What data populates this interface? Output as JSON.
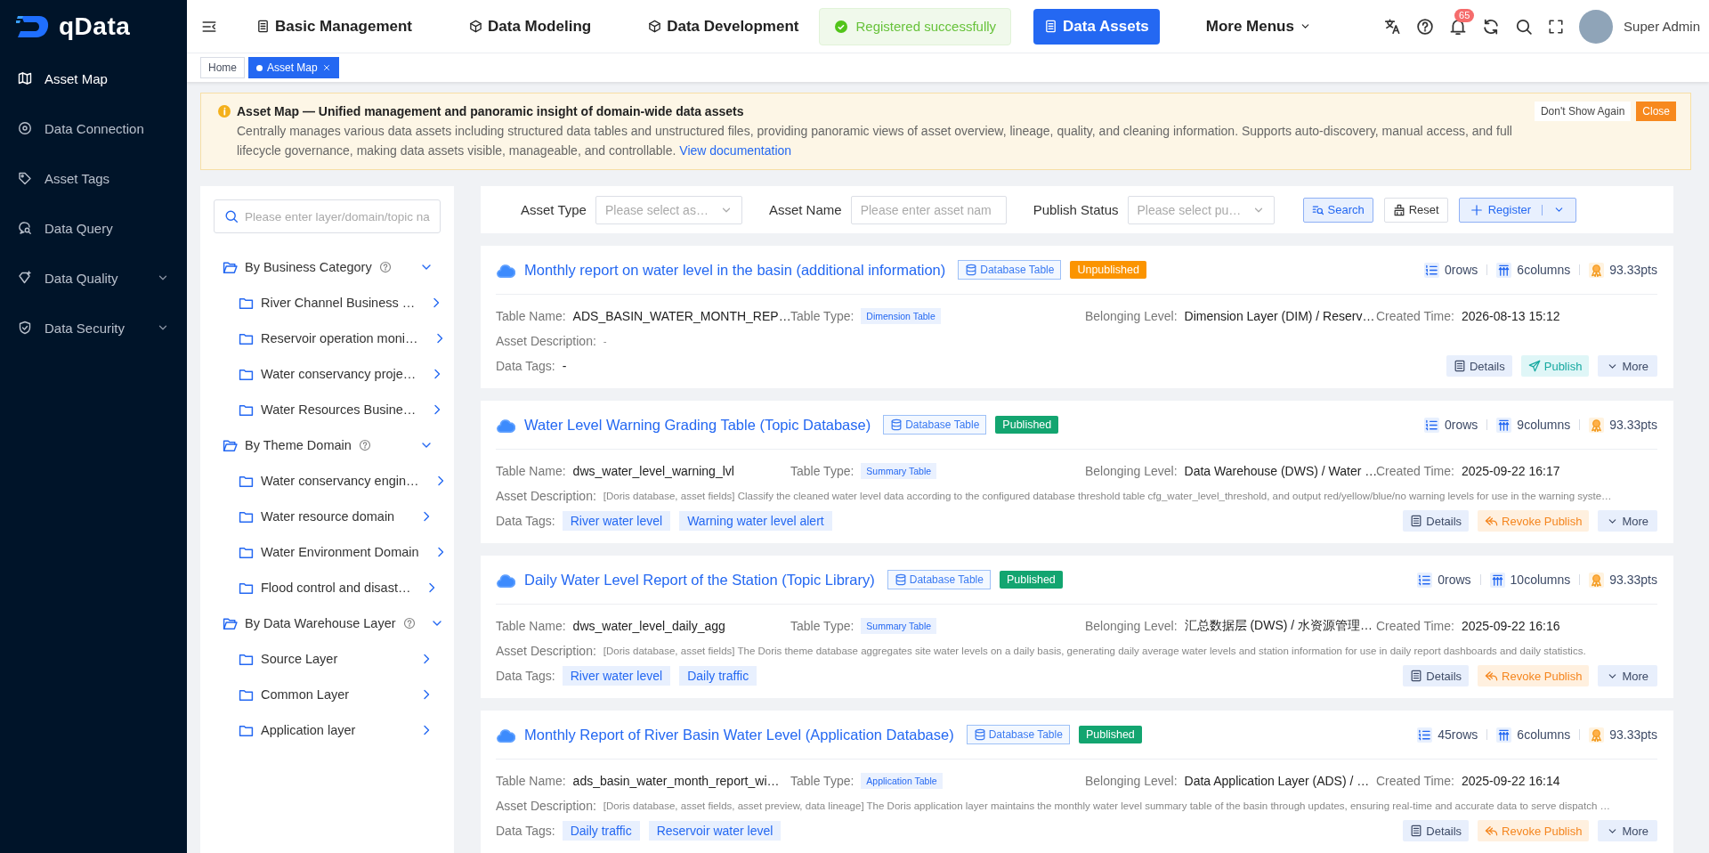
{
  "brand": {
    "name": "qData"
  },
  "sidebar": {
    "items": [
      {
        "label": "Asset Map",
        "selected": true,
        "kind": "link"
      },
      {
        "label": "Data Connection",
        "selected": false,
        "kind": "link"
      },
      {
        "label": "Asset Tags",
        "selected": false,
        "kind": "link"
      },
      {
        "label": "Data Query",
        "selected": false,
        "kind": "link"
      },
      {
        "label": "Data Quality",
        "selected": false,
        "kind": "group"
      },
      {
        "label": "Data Security",
        "selected": false,
        "kind": "group"
      }
    ]
  },
  "topbar": {
    "menus": [
      {
        "label": "Basic Management",
        "selected": false,
        "kind": "link"
      },
      {
        "label": "Data Modeling",
        "selected": false,
        "kind": "link"
      },
      {
        "label": "Data Development",
        "selected": false,
        "kind": "link"
      },
      {
        "label": "Data Assets",
        "selected": true,
        "kind": "link"
      },
      {
        "label": "More Menus",
        "selected": false,
        "kind": "dropdown"
      }
    ],
    "toast": "Registered successfully",
    "notification_count": "65",
    "user": "Super Admin"
  },
  "page_tabs": [
    {
      "label": "Home",
      "selected": false,
      "closable": false
    },
    {
      "label": "Asset Map",
      "selected": true,
      "closable": true
    }
  ],
  "notice": {
    "title": "Asset Map — Unified management and panoramic insight of domain-wide data assets",
    "body": "Centrally manages various data assets including structured data tables and unstructured files, providing panoramic views of asset overview, lineage, quality, and cleaning information. Supports auto-discovery, manual access, and full lifecycle governance, making data assets visible, manageable, and controllable.",
    "link": "View documentation",
    "dismiss": "Don't Show Again",
    "close": "Close"
  },
  "tree": {
    "search_placeholder": "Please enter layer/domain/topic na",
    "groups": [
      {
        "label": "By Business Category",
        "expanded": true,
        "children": [
          {
            "label": "River Channel Business …"
          },
          {
            "label": "Reservoir operation moni…"
          },
          {
            "label": "Water conservancy proje…"
          },
          {
            "label": "Water Resources Busine…"
          }
        ]
      },
      {
        "label": "By Theme Domain",
        "expanded": true,
        "children": [
          {
            "label": "Water conservancy engin…"
          },
          {
            "label": "Water resource domain"
          },
          {
            "label": "Water Environment Domain"
          },
          {
            "label": "Flood control and disast…"
          }
        ]
      },
      {
        "label": "By Data Warehouse Layer",
        "expanded": true,
        "children": [
          {
            "label": "Source Layer"
          },
          {
            "label": "Common Layer"
          },
          {
            "label": "Application layer"
          }
        ]
      }
    ]
  },
  "filters": {
    "fields": [
      {
        "label": "Asset Type",
        "kind": "select",
        "placeholder": "Please select as…"
      },
      {
        "label": "Asset Name",
        "kind": "input",
        "placeholder": "Please enter asset nam"
      },
      {
        "label": "Publish Status",
        "kind": "select",
        "placeholder": "Please select pu…"
      }
    ],
    "buttons": [
      {
        "label": "Search",
        "kind": "search"
      },
      {
        "label": "Reset",
        "kind": "reset"
      },
      {
        "label": "Register",
        "kind": "split"
      }
    ]
  },
  "assets": [
    {
      "title": "Monthly report on water level in the basin (additional information)",
      "type_tag": "Database Table",
      "status": {
        "label": "Unpublished",
        "kind": "unpublished"
      },
      "rows": "0rows",
      "columns": "6columns",
      "score": "93.33pts",
      "fields": [
        {
          "label": "Table Name:",
          "value": "ADS_BASIN_WATER_MONTH_REP…",
          "kind": "text"
        },
        {
          "label": "Table Type:",
          "value": "Dimension Table",
          "kind": "tag"
        },
        {
          "label": "Belonging Level:",
          "value": "Dimension Layer (DIM) / Reserv…",
          "kind": "text"
        },
        {
          "label": "Created Time:",
          "value": "2026-08-13 15:12",
          "kind": "text"
        }
      ],
      "description": {
        "label": "Asset Description:",
        "value": "-"
      },
      "tags": {
        "label": "Data Tags:",
        "text": "-"
      },
      "actions": [
        {
          "label": "Details",
          "kind": "details"
        },
        {
          "label": "Publish",
          "kind": "publish"
        },
        {
          "label": "More",
          "kind": "more"
        }
      ]
    },
    {
      "title": "Water Level Warning Grading Table (Topic Database)",
      "type_tag": "Database Table",
      "status": {
        "label": "Published",
        "kind": "published"
      },
      "rows": "0rows",
      "columns": "9columns",
      "score": "93.33pts",
      "fields": [
        {
          "label": "Table Name:",
          "value": "dws_water_level_warning_lvl",
          "kind": "text"
        },
        {
          "label": "Table Type:",
          "value": "Summary Table",
          "kind": "tag"
        },
        {
          "label": "Belonging Level:",
          "value": "Data Warehouse (DWS) / Water …",
          "kind": "text"
        },
        {
          "label": "Created Time:",
          "value": "2025-09-22 16:17",
          "kind": "text"
        }
      ],
      "description": {
        "label": "Asset Description:",
        "value": "[Doris database, asset fields] Classify the cleaned water level data according to the configured database threshold table cfg_water_level_threshold, and output red/yellow/blue/no warning levels for use in the warning syste…"
      },
      "tags": {
        "label": "Data Tags:",
        "items": [
          "River water level",
          "Warning water level alert"
        ]
      },
      "actions": [
        {
          "label": "Details",
          "kind": "details"
        },
        {
          "label": "Revoke Publish",
          "kind": "revoke"
        },
        {
          "label": "More",
          "kind": "more"
        }
      ]
    },
    {
      "title": "Daily Water Level Report of the Station (Topic Library)",
      "type_tag": "Database Table",
      "status": {
        "label": "Published",
        "kind": "published"
      },
      "rows": "0rows",
      "columns": "10columns",
      "score": "93.33pts",
      "fields": [
        {
          "label": "Table Name:",
          "value": "dws_water_level_daily_agg",
          "kind": "text"
        },
        {
          "label": "Table Type:",
          "value": "Summary Table",
          "kind": "tag"
        },
        {
          "label": "Belonging Level:",
          "value": "汇总数据层 (DWS) / 水资源管理…",
          "kind": "text"
        },
        {
          "label": "Created Time:",
          "value": "2025-09-22 16:16",
          "kind": "text"
        }
      ],
      "description": {
        "label": "Asset Description:",
        "value": "[Doris database, asset fields] The Doris theme database aggregates site water levels on a daily basis, generating daily average water levels and station information for use in daily report dashboards and daily statistics."
      },
      "tags": {
        "label": "Data Tags:",
        "items": [
          "River water level",
          "Daily traffic"
        ]
      },
      "actions": [
        {
          "label": "Details",
          "kind": "details"
        },
        {
          "label": "Revoke Publish",
          "kind": "revoke"
        },
        {
          "label": "More",
          "kind": "more"
        }
      ]
    },
    {
      "title": "Monthly Report of River Basin Water Level (Application Database)",
      "type_tag": "Database Table",
      "status": {
        "label": "Published",
        "kind": "published"
      },
      "rows": "45rows",
      "columns": "6columns",
      "score": "93.33pts",
      "fields": [
        {
          "label": "Table Name:",
          "value": "ads_basin_water_month_report_wi…",
          "kind": "text"
        },
        {
          "label": "Table Type:",
          "value": "Application Table",
          "kind": "tag"
        },
        {
          "label": "Belonging Level:",
          "value": "Data Application Layer (ADS) / …",
          "kind": "text"
        },
        {
          "label": "Created Time:",
          "value": "2025-09-22 16:14",
          "kind": "text"
        }
      ],
      "description": {
        "label": "Asset Description:",
        "value": "[Doris database, asset fields, asset preview, data lineage] The Doris application layer maintains the monthly water level summary table of the basin through updates, ensuring real-time and accurate data to serve dispatch …"
      },
      "tags": {
        "label": "Data Tags:",
        "items": [
          "Daily traffic",
          "Reservoir water level"
        ]
      },
      "actions": [
        {
          "label": "Details",
          "kind": "details"
        },
        {
          "label": "Revoke Publish",
          "kind": "revoke"
        },
        {
          "label": "More",
          "kind": "more"
        }
      ]
    }
  ]
}
